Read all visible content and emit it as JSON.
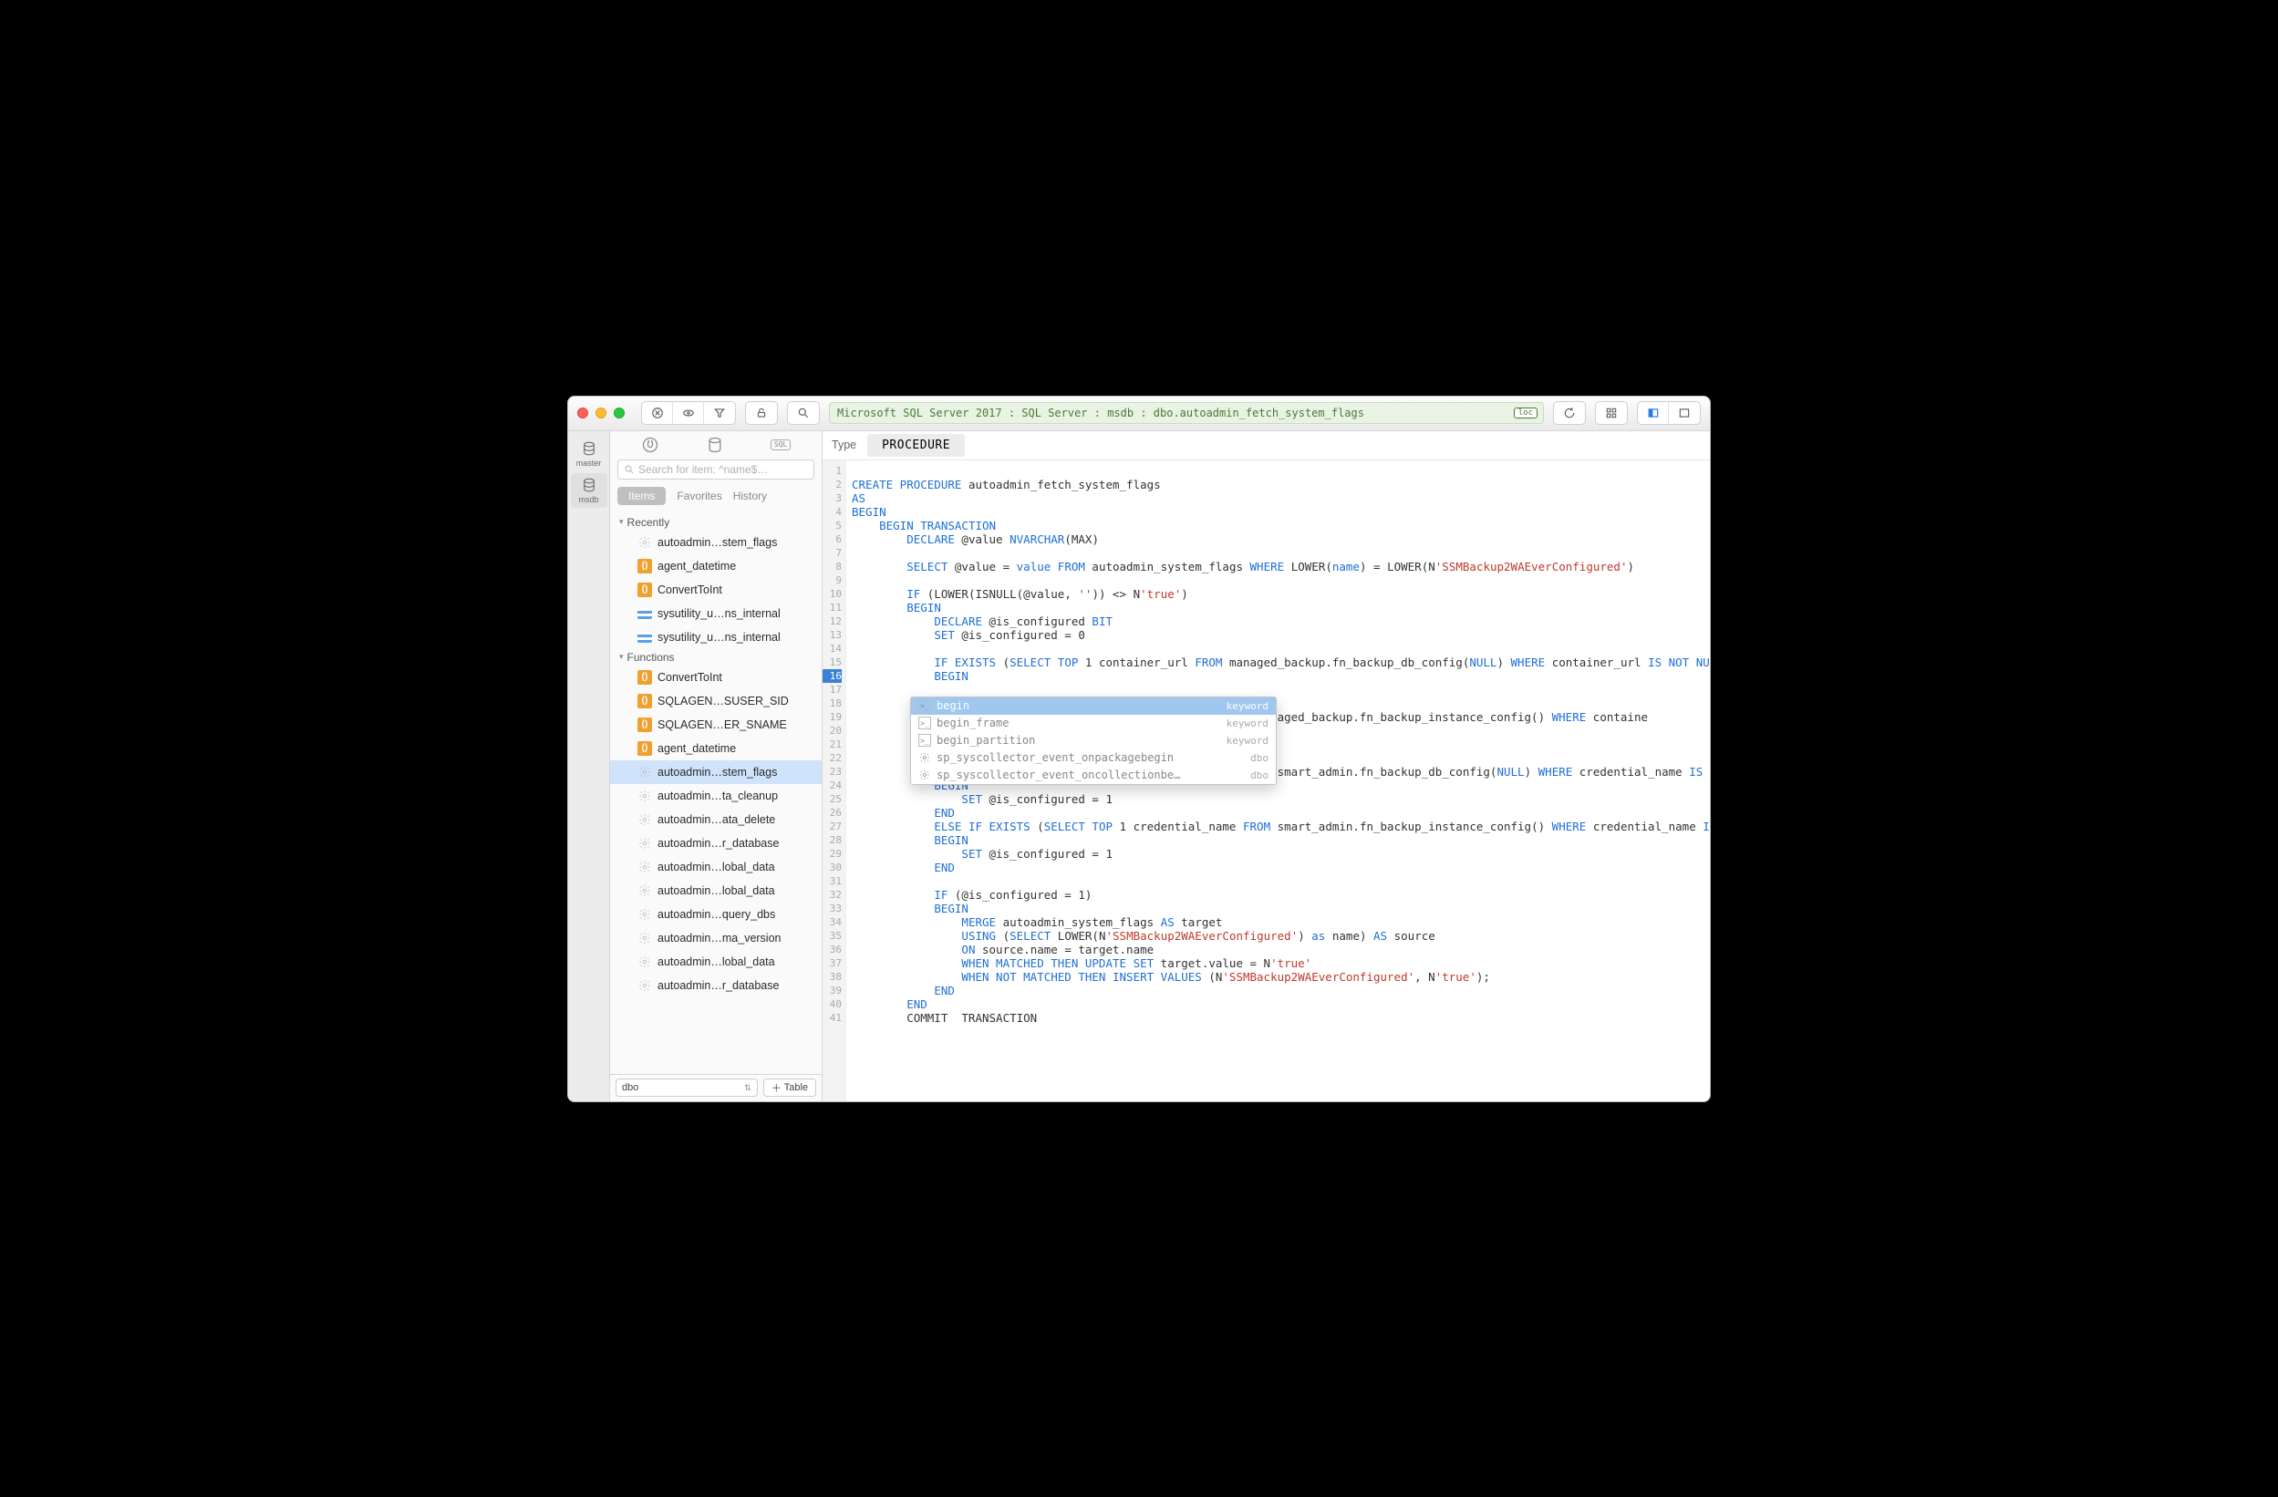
{
  "breadcrumb": "Microsoft SQL Server 2017 : SQL Server : msdb : dbo.autoadmin_fetch_system_flags",
  "breadcrumb_tag": "loc",
  "rail": {
    "items": [
      {
        "label": "master"
      },
      {
        "label": "msdb"
      }
    ]
  },
  "sidebar": {
    "top_box_label": "SQL",
    "search_placeholder": "Search for item: ^name$…",
    "tabs": {
      "active": "Items",
      "others": [
        "Favorites",
        "History"
      ]
    },
    "sections": [
      {
        "title": "Recently",
        "items": [
          {
            "icon": "gear",
            "label": "autoadmin…stem_flags"
          },
          {
            "icon": "orange",
            "glyph": "()",
            "label": "agent_datetime"
          },
          {
            "icon": "orange",
            "glyph": "()",
            "label": "ConvertToInt"
          },
          {
            "icon": "blue",
            "label": "sysutility_u…ns_internal"
          },
          {
            "icon": "blue",
            "label": "sysutility_u…ns_internal"
          }
        ]
      },
      {
        "title": "Functions",
        "items": [
          {
            "icon": "orange",
            "glyph": "()",
            "label": "ConvertToInt"
          },
          {
            "icon": "orange",
            "glyph": "()",
            "label": "SQLAGEN…SUSER_SID"
          },
          {
            "icon": "orange",
            "glyph": "()",
            "label": "SQLAGEN…ER_SNAME"
          },
          {
            "icon": "orange",
            "glyph": "()",
            "label": "agent_datetime"
          },
          {
            "icon": "gear",
            "label": "autoadmin…stem_flags",
            "selected": true
          },
          {
            "icon": "gear",
            "label": "autoadmin…ta_cleanup"
          },
          {
            "icon": "gear",
            "label": "autoadmin…ata_delete"
          },
          {
            "icon": "gear",
            "label": "autoadmin…r_database"
          },
          {
            "icon": "gear",
            "label": "autoadmin…lobal_data"
          },
          {
            "icon": "gear",
            "label": "autoadmin…lobal_data"
          },
          {
            "icon": "gear",
            "label": "autoadmin…query_dbs"
          },
          {
            "icon": "gear",
            "label": "autoadmin…ma_version"
          },
          {
            "icon": "gear",
            "label": "autoadmin…lobal_data"
          },
          {
            "icon": "gear",
            "label": "autoadmin…r_database"
          }
        ]
      }
    ],
    "schema": "dbo",
    "add_btn": "Table"
  },
  "typebar": {
    "label": "Type",
    "value": "PROCEDURE"
  },
  "code_lines": [
    {
      "n": 1,
      "html": ""
    },
    {
      "n": 2,
      "html": "<span class='kw'>CREATE PROCEDURE</span> autoadmin_fetch_system_flags"
    },
    {
      "n": 3,
      "html": "<span class='kw'>AS</span>"
    },
    {
      "n": 4,
      "html": "<span class='kw'>BEGIN</span>"
    },
    {
      "n": 5,
      "html": "    <span class='kw'>BEGIN TRANSACTION</span>"
    },
    {
      "n": 6,
      "html": "        <span class='kw'>DECLARE</span> @value <span class='kw'>NVARCHAR</span>(MAX)"
    },
    {
      "n": 7,
      "html": ""
    },
    {
      "n": 8,
      "html": "        <span class='kw'>SELECT</span> @value = <span class='kw'>value FROM</span> autoadmin_system_flags <span class='kw'>WHERE</span> LOWER(<span class='kw'>name</span>) = LOWER(N<span class='str'>'SSMBackup2WAEverConfigured'</span>)"
    },
    {
      "n": 9,
      "html": ""
    },
    {
      "n": 10,
      "html": "        <span class='kw'>IF</span> (LOWER(ISNULL(@value, <span class='str'>''</span>)) &lt;&gt; N<span class='str'>'true'</span>)"
    },
    {
      "n": 11,
      "html": "        <span class='kw'>BEGIN</span>"
    },
    {
      "n": 12,
      "html": "            <span class='kw'>DECLARE</span> @is_configured <span class='kw'>BIT</span>"
    },
    {
      "n": 13,
      "html": "            <span class='kw'>SET</span> @is_configured = 0"
    },
    {
      "n": 14,
      "html": ""
    },
    {
      "n": 15,
      "html": "            <span class='kw'>IF EXISTS</span> (<span class='kw'>SELECT TOP</span> 1 container_url <span class='kw'>FROM</span> managed_backup.fn_backup_db_config(<span class='kw'>NULL</span>) <span class='kw'>WHERE</span> container_url <span class='kw'>IS NOT NULL</span>)"
    },
    {
      "n": 16,
      "html": "            <span class='kw'>BEGIN</span>",
      "hl": true
    },
    {
      "n": 17,
      "html": ""
    },
    {
      "n": 18,
      "html": ""
    },
    {
      "n": 19,
      "html": "                                                           managed_backup.fn_backup_instance_config() <span class='kw'>WHERE</span> containe"
    },
    {
      "n": 20,
      "html": ""
    },
    {
      "n": 21,
      "html": ""
    },
    {
      "n": 22,
      "html": ""
    },
    {
      "n": 23,
      "html": "            <span class='kw'>ELSE IF EXISTS</span> (<span class='kw'>SELECT TOP</span> 1 credential_name <span class='kw'>FROM</span> smart_admin.fn_backup_db_config(<span class='kw'>NULL</span>) <span class='kw'>WHERE</span> credential_name <span class='kw'>IS NOT NULL</span>)"
    },
    {
      "n": 24,
      "html": "            <span class='kw'>BEGIN</span>"
    },
    {
      "n": 25,
      "html": "                <span class='kw'>SET</span> @is_configured = 1"
    },
    {
      "n": 26,
      "html": "            <span class='kw'>END</span>"
    },
    {
      "n": 27,
      "html": "            <span class='kw'>ELSE IF EXISTS</span> (<span class='kw'>SELECT TOP</span> 1 credential_name <span class='kw'>FROM</span> smart_admin.fn_backup_instance_config() <span class='kw'>WHERE</span> credential_name <span class='kw'>IS NOT NULL</span>)"
    },
    {
      "n": 28,
      "html": "            <span class='kw'>BEGIN</span>"
    },
    {
      "n": 29,
      "html": "                <span class='kw'>SET</span> @is_configured = 1"
    },
    {
      "n": 30,
      "html": "            <span class='kw'>END</span>"
    },
    {
      "n": 31,
      "html": ""
    },
    {
      "n": 32,
      "html": "            <span class='kw'>IF</span> (@is_configured = 1)"
    },
    {
      "n": 33,
      "html": "            <span class='kw'>BEGIN</span>"
    },
    {
      "n": 34,
      "html": "                <span class='kw'>MERGE</span> autoadmin_system_flags <span class='kw'>AS</span> target"
    },
    {
      "n": 35,
      "html": "                <span class='kw'>USING</span> (<span class='kw'>SELECT</span> LOWER(N<span class='str'>'SSMBackup2WAEverConfigured'</span>) <span class='kw'>as</span> name) <span class='kw'>AS</span> source"
    },
    {
      "n": 36,
      "html": "                <span class='kw'>ON</span> source.name = target.name"
    },
    {
      "n": 37,
      "html": "                <span class='kw'>WHEN MATCHED THEN UPDATE SET</span> target.value = N<span class='str'>'true'</span>"
    },
    {
      "n": 38,
      "html": "                <span class='kw'>WHEN NOT MATCHED THEN INSERT VALUES</span> (N<span class='str'>'SSMBackup2WAEverConfigured'</span>, N<span class='str'>'true'</span>);"
    },
    {
      "n": 39,
      "html": "            <span class='kw'>END</span>"
    },
    {
      "n": 40,
      "html": "        <span class='kw'>END</span>"
    },
    {
      "n": 41,
      "html": "        COMMIT  TRANSACTION"
    }
  ],
  "popup": {
    "items": [
      {
        "icon": "box",
        "label": "begin",
        "right": "keyword",
        "selected": true
      },
      {
        "icon": "box",
        "label": "begin_frame",
        "right": "keyword"
      },
      {
        "icon": "box",
        "label": "begin_partition",
        "right": "keyword"
      },
      {
        "icon": "gear",
        "label": "sp_syscollector_event_onpackagebegin",
        "right": "dbo"
      },
      {
        "icon": "gear",
        "label": "sp_syscollector_event_oncollectionbe…",
        "right": "dbo"
      }
    ]
  }
}
